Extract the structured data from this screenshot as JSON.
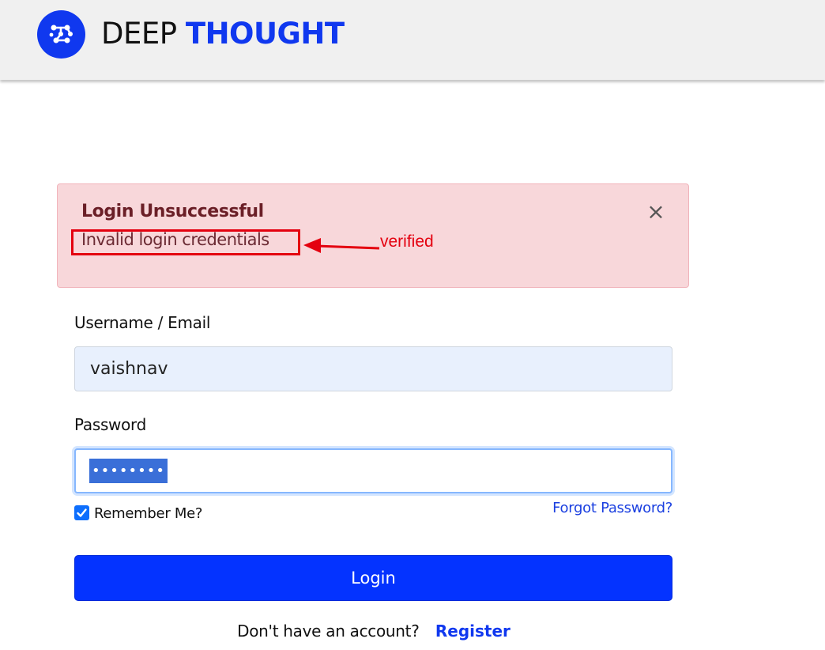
{
  "header": {
    "brand_word1": "DEEP",
    "brand_word2": "THOUGHT",
    "logo_icon": "network-nodes-icon",
    "brand_color": "#1038ef"
  },
  "alert": {
    "title": "Login Unsuccessful",
    "message": "Invalid login credentials",
    "close_symbol": "×",
    "annotation_text": "verified",
    "background": "#f8d7da",
    "annotation_color": "#e4000f"
  },
  "form": {
    "username_label": "Username / Email",
    "username_value": "vaishnav",
    "password_label": "Password",
    "password_mask": "••••••••",
    "remember_label": "Remember Me?",
    "remember_checked": true,
    "forgot_link": "Forgot Password?",
    "login_button": "Login",
    "login_button_color": "#0433ff"
  },
  "footer": {
    "prompt": "Don't have an account?",
    "register_link": "Register"
  }
}
